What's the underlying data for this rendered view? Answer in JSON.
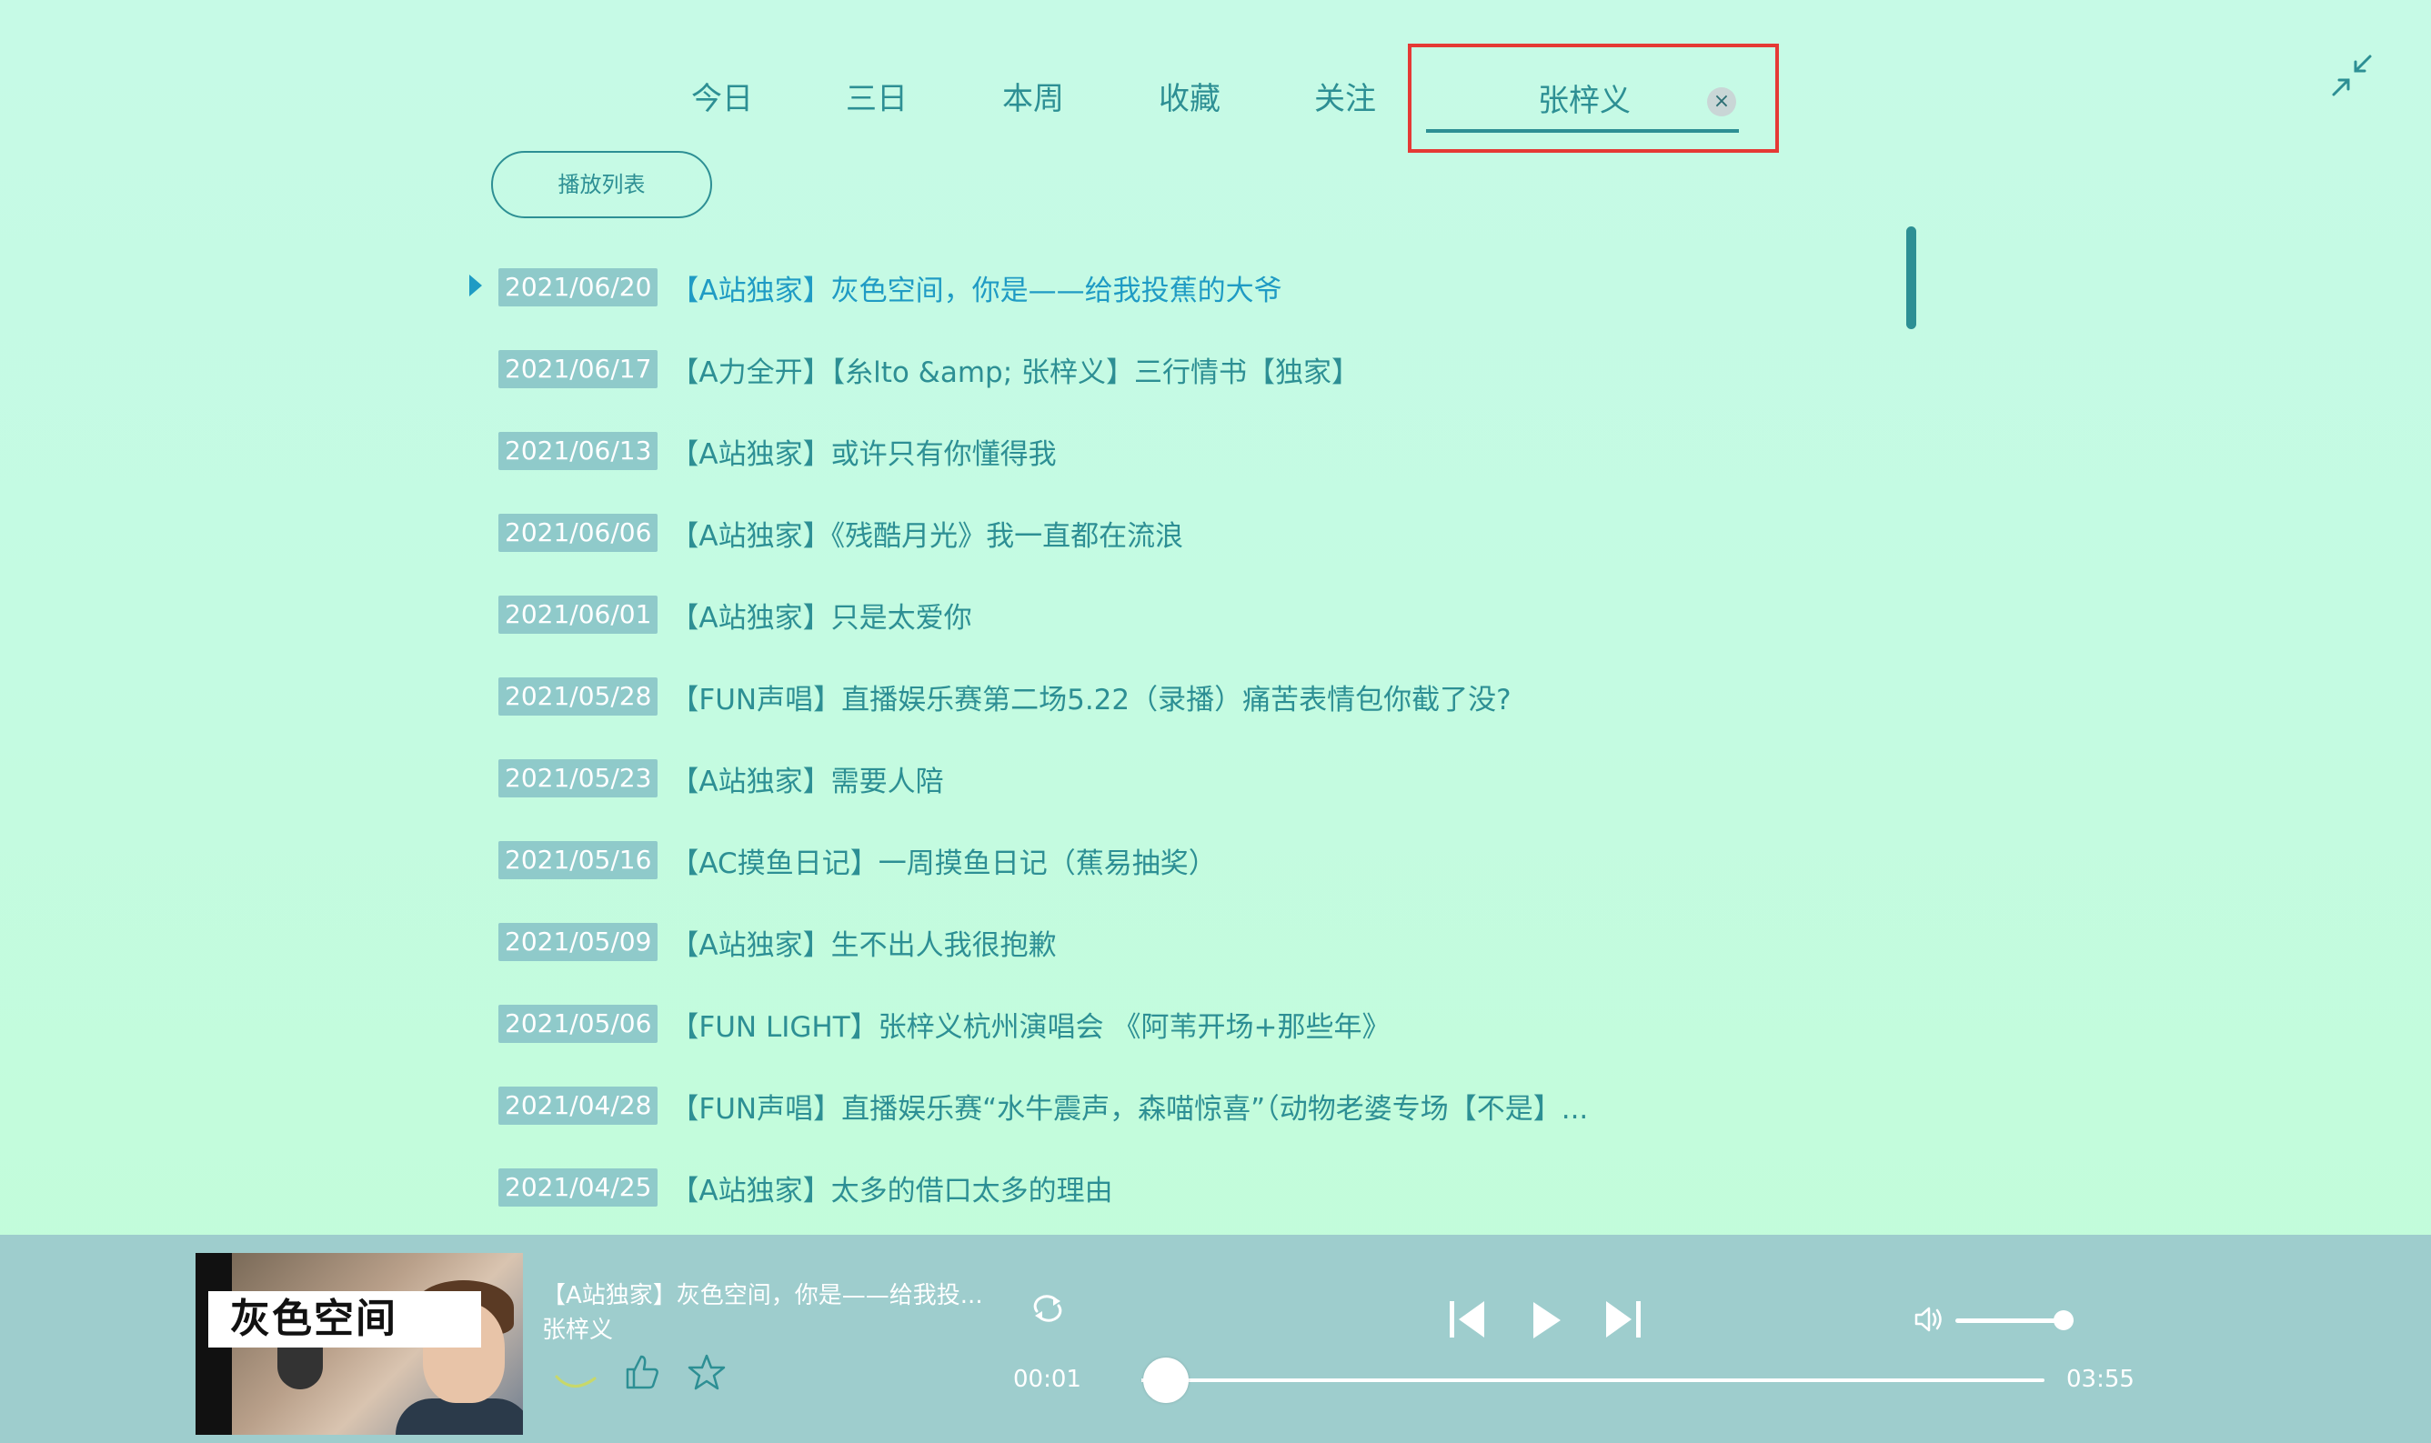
{
  "tabs": {
    "items": [
      "今日",
      "三日",
      "本周",
      "收藏",
      "关注"
    ],
    "active": "张梓义",
    "close_glyph": "×"
  },
  "playlist_button": "播放列表",
  "songs": [
    {
      "date": "2021/06/20",
      "title": "【A站独家】灰色空间，你是——给我投蕉的大爷",
      "current": true
    },
    {
      "date": "2021/06/17",
      "title": "【A力全开】【糸lto &amp; 张梓义】三行情书【独家】"
    },
    {
      "date": "2021/06/13",
      "title": "【A站独家】或许只有你懂得我"
    },
    {
      "date": "2021/06/06",
      "title": "【A站独家】《残酷月光》我一直都在流浪"
    },
    {
      "date": "2021/06/01",
      "title": "【A站独家】只是太爱你"
    },
    {
      "date": "2021/05/28",
      "title": "【FUN声唱】直播娱乐赛第二场5.22（录播）痛苦表情包你截了没?"
    },
    {
      "date": "2021/05/23",
      "title": "【A站独家】需要人陪"
    },
    {
      "date": "2021/05/16",
      "title": "【AC摸鱼日记】一周摸鱼日记（蕉易抽奖）"
    },
    {
      "date": "2021/05/09",
      "title": "【A站独家】生不出人我很抱歉"
    },
    {
      "date": "2021/05/06",
      "title": "【FUN LIGHT】张梓义杭州演唱会 《阿苇开场+那些年》"
    },
    {
      "date": "2021/04/28",
      "title": "【FUN声唱】直播娱乐赛“水牛震声，森喵惊喜”（动物老婆专场【不是】..."
    },
    {
      "date": "2021/04/25",
      "title": "【A站独家】太多的借口太多的理由"
    }
  ],
  "player": {
    "cover_caption": "灰色空间",
    "title": "【A站独家】灰色空间，你是——给我投...",
    "artist": "张梓义",
    "current_time": "00:01",
    "total_time": "03:55",
    "progress": 0.004,
    "volume": 1.0,
    "icons": [
      "banana-icon",
      "thumbs-up-icon",
      "star-icon",
      "loop-icon",
      "previous-icon",
      "play-icon",
      "next-icon",
      "volume-icon"
    ]
  },
  "colors": {
    "accent": "#2d8f94",
    "current_song": "#1f9bc4",
    "date_badge": "#8fcaca",
    "player_bar": "#9ecdcd",
    "tab_highlight_box": "#e53935"
  }
}
